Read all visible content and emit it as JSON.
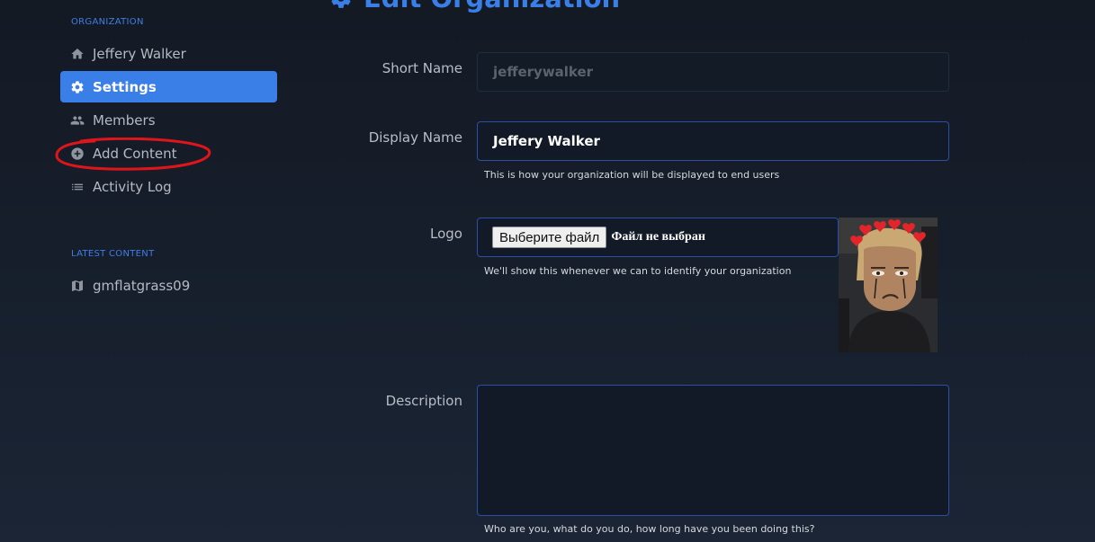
{
  "sidebar": {
    "organization_title": "ORGANIZATION",
    "items": [
      {
        "label": "Jeffery Walker",
        "icon": "home-icon"
      },
      {
        "label": "Settings",
        "icon": "gear-icon",
        "active": true
      },
      {
        "label": "Members",
        "icon": "people-icon"
      },
      {
        "label": "Add Content",
        "icon": "plus-circle-icon"
      },
      {
        "label": "Activity Log",
        "icon": "list-icon"
      }
    ],
    "latest_title": "LATEST CONTENT",
    "latest_items": [
      {
        "label": "gmflatgrass09",
        "icon": "map-icon"
      }
    ]
  },
  "page": {
    "title": "Edit Organization"
  },
  "form": {
    "short_name": {
      "label": "Short Name",
      "value": "jefferywalker"
    },
    "display_name": {
      "label": "Display Name",
      "value": "Jeffery Walker",
      "help": "This is how your organization will be displayed to end users"
    },
    "logo": {
      "label": "Logo",
      "button": "Выберите файл",
      "status": "Файл не выбран",
      "help": "We'll show this whenever we can to identify your organization"
    },
    "description": {
      "label": "Description",
      "value": "",
      "help": "Who are you, what do you do, how long have you been doing this?"
    }
  },
  "colors": {
    "accent": "#3a7ee8",
    "background": "#161e2b",
    "annotation": "#e0151b"
  }
}
